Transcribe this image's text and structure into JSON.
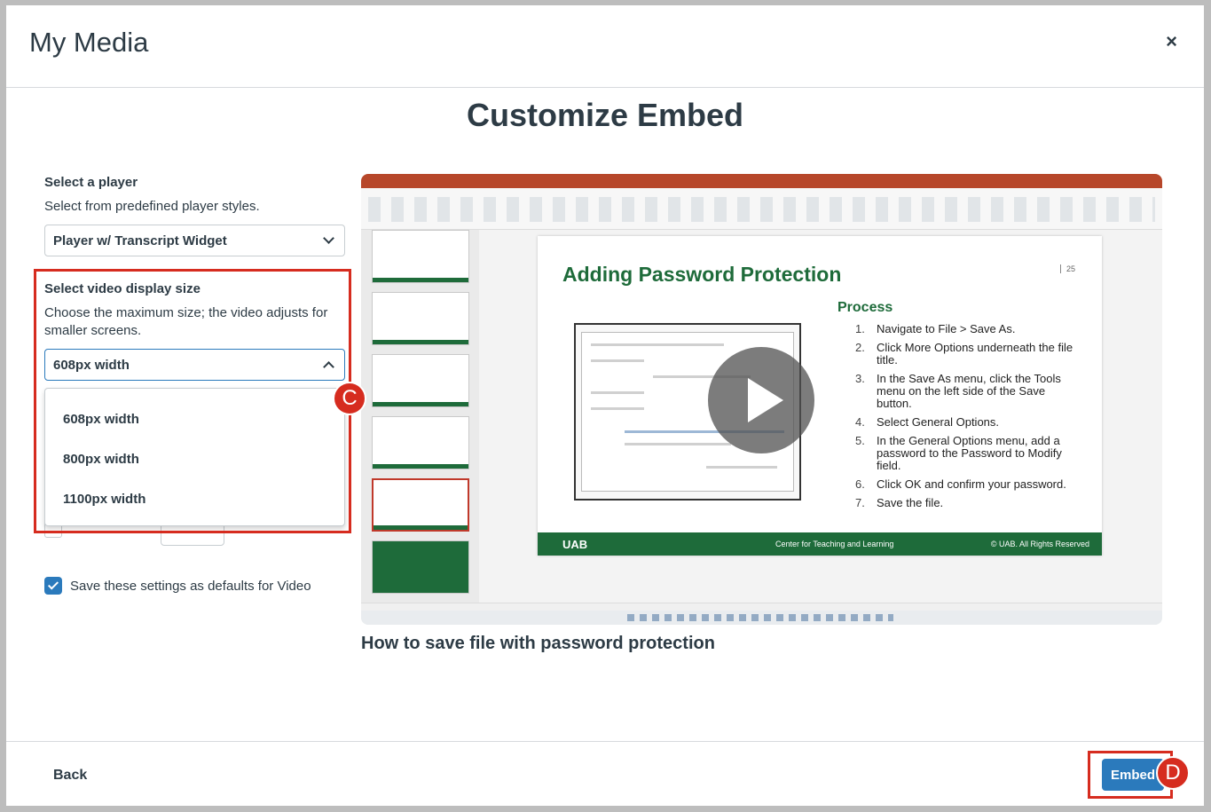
{
  "modal": {
    "title": "My Media",
    "close_label": "×"
  },
  "page_title": "Customize Embed",
  "player": {
    "label": "Select a player",
    "description": "Select from predefined player styles.",
    "selected": "Player w/ Transcript Widget"
  },
  "display_size": {
    "label": "Select video display size",
    "description": "Choose the maximum size; the video adjusts for smaller screens.",
    "selected": "608px width",
    "options": [
      "608px width",
      "800px width",
      "1100px width"
    ]
  },
  "defaults_checkbox": {
    "label": "Save these settings as defaults for Video",
    "checked": true
  },
  "video": {
    "title": "How to save file with password protection",
    "slide": {
      "title": "Adding Password Protection",
      "number": "25",
      "process_heading": "Process",
      "steps": [
        {
          "n": "1.",
          "text": "Navigate to File > Save As."
        },
        {
          "n": "2.",
          "text": "Click More Options underneath the file title."
        },
        {
          "n": "3.",
          "text": "In the Save As menu, click the Tools menu on the left side of the Save button."
        },
        {
          "n": "4.",
          "text": "Select General Options."
        },
        {
          "n": "5.",
          "text": "In the General Options menu, add a password to the Password to Modify field."
        },
        {
          "n": "6.",
          "text": "Click OK and confirm your password."
        },
        {
          "n": "7.",
          "text": "Save the file."
        }
      ],
      "footer_logo": "UAB",
      "footer_center": "Center for Teaching and Learning",
      "footer_right": "© UAB. All Rights Reserved"
    }
  },
  "annotations": {
    "c": "C",
    "d": "D"
  },
  "footer": {
    "back_label": "Back",
    "embed_label": "Embed"
  },
  "colors": {
    "accent": "#2b7abc",
    "highlight": "#d62c1f",
    "slide_green": "#1e6b3a",
    "ppt_red": "#b7472a"
  },
  "icons": {
    "close": "close-icon",
    "chevron": "chevron-icon",
    "play": "play-icon",
    "check": "check-icon"
  }
}
